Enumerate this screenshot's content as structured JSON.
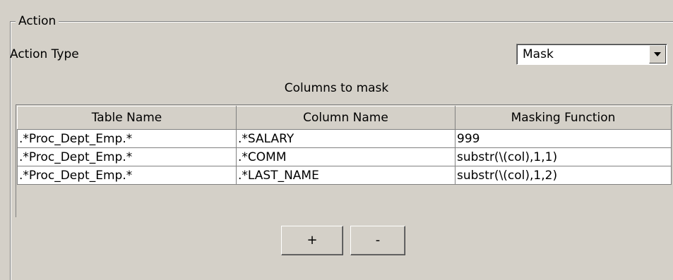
{
  "action_group": {
    "title": "Action"
  },
  "action_type": {
    "label": "Action Type",
    "selected": "Mask"
  },
  "columns_section": {
    "label": "Columns to mask"
  },
  "table": {
    "headers": [
      "Table Name",
      "Column Name",
      "Masking Function"
    ],
    "rows": [
      [
        ".*Proc_Dept_Emp.*",
        ".*SALARY",
        "999"
      ],
      [
        ".*Proc_Dept_Emp.*",
        ".*COMM",
        "substr(\\(col),1,1)"
      ],
      [
        ".*Proc_Dept_Emp.*",
        ".*LAST_NAME",
        "substr(\\(col),1,2)"
      ]
    ]
  },
  "buttons": {
    "add_label": "+",
    "remove_label": "-"
  },
  "icons": {
    "dropdown": "chevron-down-icon"
  }
}
